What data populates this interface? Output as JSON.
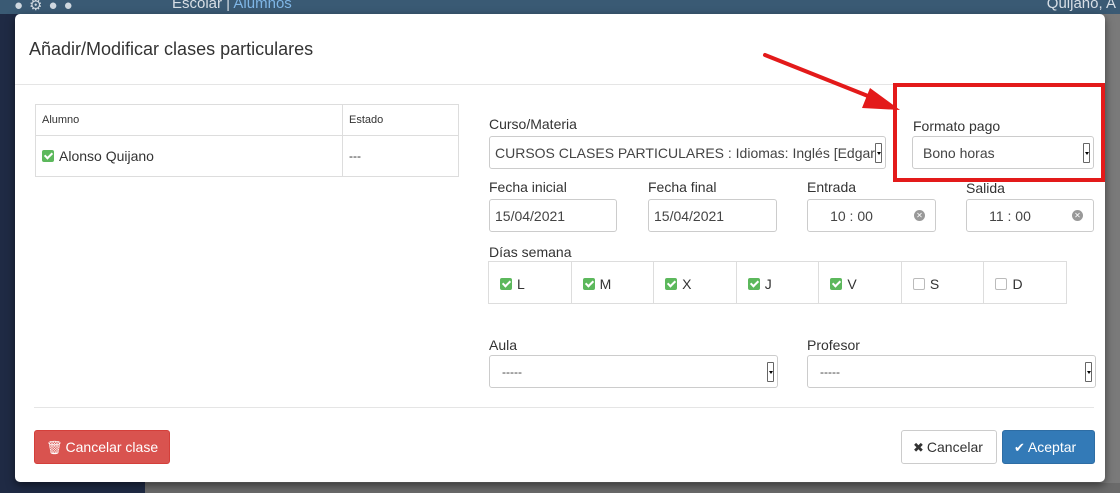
{
  "background": {
    "crumb_prefix": "Escolar | ",
    "crumb_active": "Alumnos",
    "user": "Quijano, A"
  },
  "modal": {
    "title": "Añadir/Modificar clases particulares"
  },
  "students_table": {
    "headers": [
      "Alumno",
      "Estado"
    ],
    "rows": [
      {
        "alumno": "Alonso Quijano",
        "estado": "---",
        "checked": true
      }
    ]
  },
  "form": {
    "curso_label": "Curso/Materia",
    "curso_value": "CURSOS CLASES PARTICULARES : Idiomas: Inglés [Edgar P",
    "formato_label": "Formato pago",
    "formato_value": "Bono horas",
    "fecha_inicial_label": "Fecha inicial",
    "fecha_inicial_value": "15/04/2021",
    "fecha_final_label": "Fecha final",
    "fecha_final_value": "15/04/2021",
    "entrada_label": "Entrada",
    "entrada_value": "10 : 00",
    "salida_label": "Salida",
    "salida_value": "11 : 00",
    "dias_label": "Días semana",
    "dias": [
      {
        "label": "L",
        "checked": true
      },
      {
        "label": "M",
        "checked": true
      },
      {
        "label": "X",
        "checked": true
      },
      {
        "label": "J",
        "checked": true
      },
      {
        "label": "V",
        "checked": true
      },
      {
        "label": "S",
        "checked": false
      },
      {
        "label": "D",
        "checked": false
      }
    ],
    "aula_label": "Aula",
    "aula_value": "-----",
    "profesor_label": "Profesor",
    "profesor_value": "-----"
  },
  "buttons": {
    "cancelar_clase": "Cancelar clase",
    "cancelar": "Cancelar",
    "aceptar": "Aceptar"
  },
  "colors": {
    "annotation": "#e31a1a",
    "primary": "#337ab7",
    "danger": "#d9534f",
    "success": "#5cb85c"
  }
}
